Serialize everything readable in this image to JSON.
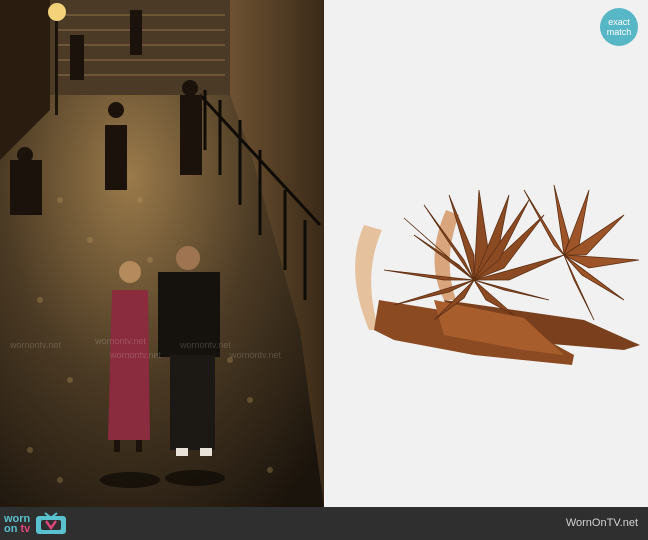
{
  "badge": {
    "line1": "exact",
    "line2": "match"
  },
  "watermarks": [
    "wornontv.net",
    "wornontv.net",
    "wornontv.net",
    "wornontv.net",
    "wornontv.net"
  ],
  "footer": {
    "logo_part1": "worn",
    "logo_part2": "on",
    "logo_part3": "tv",
    "site": "WornOnTV.net"
  },
  "colors": {
    "footer_bg": "#2f2f2f",
    "badge_bg": "#58b7c7",
    "accent_teal": "#59c1cf",
    "accent_pink": "#e0457b",
    "product_brown": "#8b4a22"
  }
}
